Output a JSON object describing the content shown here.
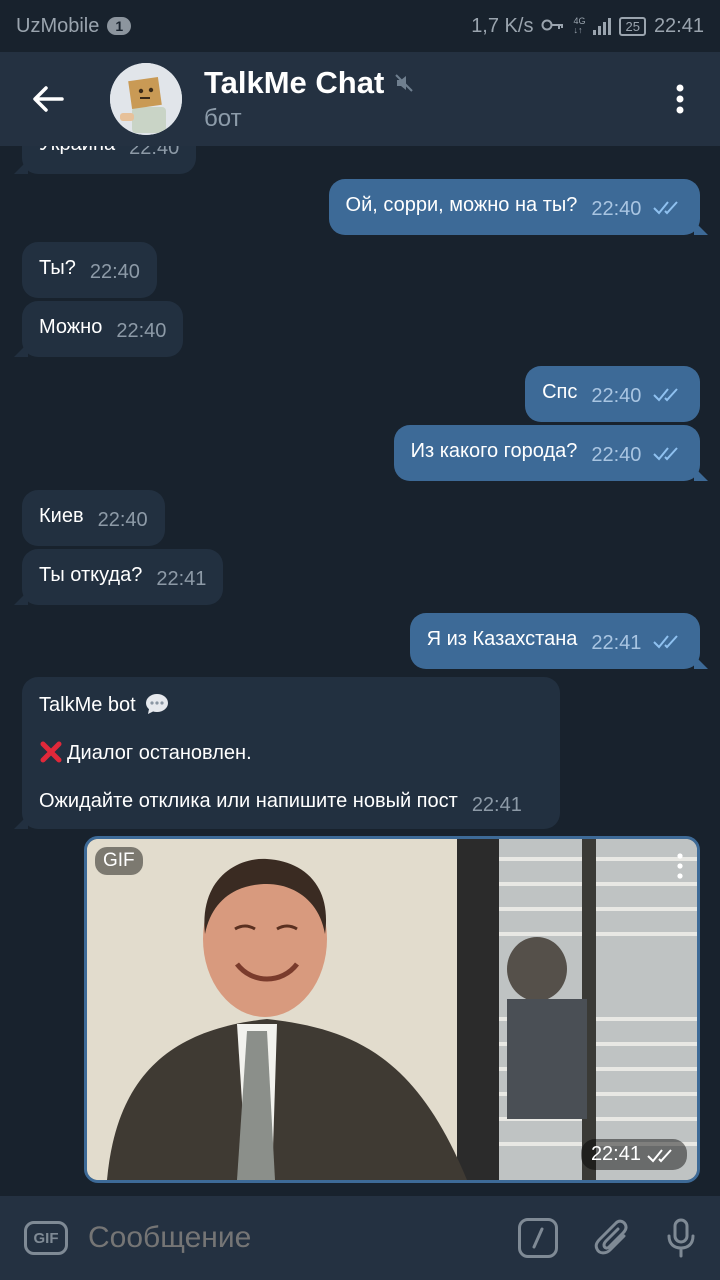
{
  "status_bar": {
    "carrier": "UzMobile",
    "notification_count": "1",
    "speed": "1,7 K/s",
    "battery": "25",
    "time": "22:41"
  },
  "header": {
    "title": "TalkMe Chat",
    "subtitle": "бот"
  },
  "messages": {
    "m0": {
      "text": "Украина",
      "time": "22:40"
    },
    "m1": {
      "text": "Ой, сорри, можно на ты?",
      "time": "22:40"
    },
    "m2": {
      "text": "Ты?",
      "time": "22:40"
    },
    "m3": {
      "text": "Можно",
      "time": "22:40"
    },
    "m4": {
      "text": "Спс",
      "time": "22:40"
    },
    "m5": {
      "text": "Из какого города?",
      "time": "22:40"
    },
    "m6": {
      "text": "Киев",
      "time": "22:40"
    },
    "m7": {
      "text": "Ты откуда?",
      "time": "22:41"
    },
    "m8": {
      "text": "Я из Казахстана",
      "time": "22:41"
    },
    "bot": {
      "line1": "TalkMe bot",
      "line2": "Диалог остановлен.",
      "line3": "Ожидайте отклика или напишите новый пост",
      "time": "22:41"
    }
  },
  "gif": {
    "badge": "GIF",
    "time": "22:41"
  },
  "input_bar": {
    "gif_label": "GIF",
    "placeholder": "Сообщение"
  },
  "colors": {
    "background": "#18222d",
    "header": "#243141",
    "incoming_bubble": "#223040",
    "outgoing_bubble": "#3d6a97",
    "check_color": "#8fc1f0"
  }
}
